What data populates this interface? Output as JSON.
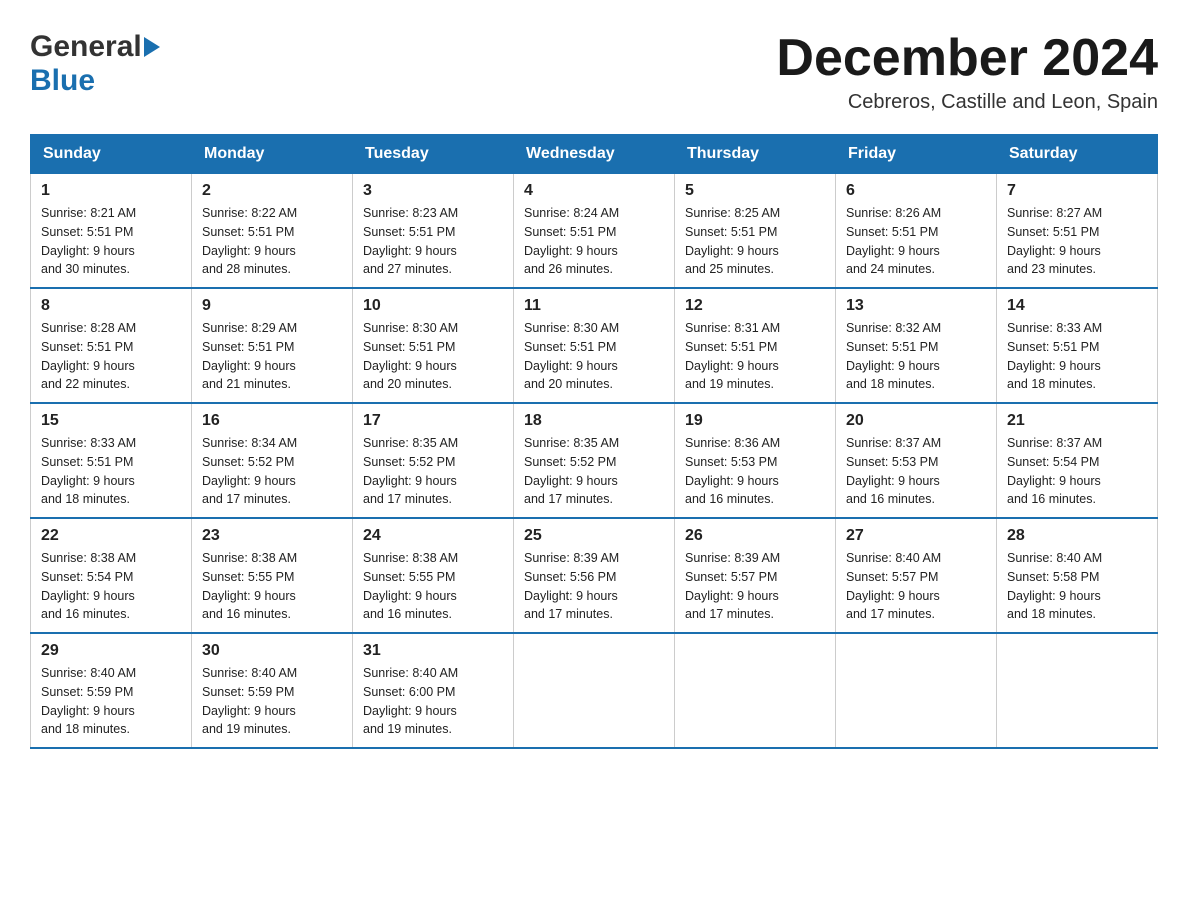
{
  "header": {
    "logo_general": "General",
    "logo_blue": "Blue",
    "month_title": "December 2024",
    "subtitle": "Cebreros, Castille and Leon, Spain"
  },
  "days_of_week": [
    "Sunday",
    "Monday",
    "Tuesday",
    "Wednesday",
    "Thursday",
    "Friday",
    "Saturday"
  ],
  "weeks": [
    [
      {
        "day": "1",
        "sunrise": "Sunrise: 8:21 AM",
        "sunset": "Sunset: 5:51 PM",
        "daylight": "Daylight: 9 hours",
        "daylight2": "and 30 minutes."
      },
      {
        "day": "2",
        "sunrise": "Sunrise: 8:22 AM",
        "sunset": "Sunset: 5:51 PM",
        "daylight": "Daylight: 9 hours",
        "daylight2": "and 28 minutes."
      },
      {
        "day": "3",
        "sunrise": "Sunrise: 8:23 AM",
        "sunset": "Sunset: 5:51 PM",
        "daylight": "Daylight: 9 hours",
        "daylight2": "and 27 minutes."
      },
      {
        "day": "4",
        "sunrise": "Sunrise: 8:24 AM",
        "sunset": "Sunset: 5:51 PM",
        "daylight": "Daylight: 9 hours",
        "daylight2": "and 26 minutes."
      },
      {
        "day": "5",
        "sunrise": "Sunrise: 8:25 AM",
        "sunset": "Sunset: 5:51 PM",
        "daylight": "Daylight: 9 hours",
        "daylight2": "and 25 minutes."
      },
      {
        "day": "6",
        "sunrise": "Sunrise: 8:26 AM",
        "sunset": "Sunset: 5:51 PM",
        "daylight": "Daylight: 9 hours",
        "daylight2": "and 24 minutes."
      },
      {
        "day": "7",
        "sunrise": "Sunrise: 8:27 AM",
        "sunset": "Sunset: 5:51 PM",
        "daylight": "Daylight: 9 hours",
        "daylight2": "and 23 minutes."
      }
    ],
    [
      {
        "day": "8",
        "sunrise": "Sunrise: 8:28 AM",
        "sunset": "Sunset: 5:51 PM",
        "daylight": "Daylight: 9 hours",
        "daylight2": "and 22 minutes."
      },
      {
        "day": "9",
        "sunrise": "Sunrise: 8:29 AM",
        "sunset": "Sunset: 5:51 PM",
        "daylight": "Daylight: 9 hours",
        "daylight2": "and 21 minutes."
      },
      {
        "day": "10",
        "sunrise": "Sunrise: 8:30 AM",
        "sunset": "Sunset: 5:51 PM",
        "daylight": "Daylight: 9 hours",
        "daylight2": "and 20 minutes."
      },
      {
        "day": "11",
        "sunrise": "Sunrise: 8:30 AM",
        "sunset": "Sunset: 5:51 PM",
        "daylight": "Daylight: 9 hours",
        "daylight2": "and 20 minutes."
      },
      {
        "day": "12",
        "sunrise": "Sunrise: 8:31 AM",
        "sunset": "Sunset: 5:51 PM",
        "daylight": "Daylight: 9 hours",
        "daylight2": "and 19 minutes."
      },
      {
        "day": "13",
        "sunrise": "Sunrise: 8:32 AM",
        "sunset": "Sunset: 5:51 PM",
        "daylight": "Daylight: 9 hours",
        "daylight2": "and 18 minutes."
      },
      {
        "day": "14",
        "sunrise": "Sunrise: 8:33 AM",
        "sunset": "Sunset: 5:51 PM",
        "daylight": "Daylight: 9 hours",
        "daylight2": "and 18 minutes."
      }
    ],
    [
      {
        "day": "15",
        "sunrise": "Sunrise: 8:33 AM",
        "sunset": "Sunset: 5:51 PM",
        "daylight": "Daylight: 9 hours",
        "daylight2": "and 18 minutes."
      },
      {
        "day": "16",
        "sunrise": "Sunrise: 8:34 AM",
        "sunset": "Sunset: 5:52 PM",
        "daylight": "Daylight: 9 hours",
        "daylight2": "and 17 minutes."
      },
      {
        "day": "17",
        "sunrise": "Sunrise: 8:35 AM",
        "sunset": "Sunset: 5:52 PM",
        "daylight": "Daylight: 9 hours",
        "daylight2": "and 17 minutes."
      },
      {
        "day": "18",
        "sunrise": "Sunrise: 8:35 AM",
        "sunset": "Sunset: 5:52 PM",
        "daylight": "Daylight: 9 hours",
        "daylight2": "and 17 minutes."
      },
      {
        "day": "19",
        "sunrise": "Sunrise: 8:36 AM",
        "sunset": "Sunset: 5:53 PM",
        "daylight": "Daylight: 9 hours",
        "daylight2": "and 16 minutes."
      },
      {
        "day": "20",
        "sunrise": "Sunrise: 8:37 AM",
        "sunset": "Sunset: 5:53 PM",
        "daylight": "Daylight: 9 hours",
        "daylight2": "and 16 minutes."
      },
      {
        "day": "21",
        "sunrise": "Sunrise: 8:37 AM",
        "sunset": "Sunset: 5:54 PM",
        "daylight": "Daylight: 9 hours",
        "daylight2": "and 16 minutes."
      }
    ],
    [
      {
        "day": "22",
        "sunrise": "Sunrise: 8:38 AM",
        "sunset": "Sunset: 5:54 PM",
        "daylight": "Daylight: 9 hours",
        "daylight2": "and 16 minutes."
      },
      {
        "day": "23",
        "sunrise": "Sunrise: 8:38 AM",
        "sunset": "Sunset: 5:55 PM",
        "daylight": "Daylight: 9 hours",
        "daylight2": "and 16 minutes."
      },
      {
        "day": "24",
        "sunrise": "Sunrise: 8:38 AM",
        "sunset": "Sunset: 5:55 PM",
        "daylight": "Daylight: 9 hours",
        "daylight2": "and 16 minutes."
      },
      {
        "day": "25",
        "sunrise": "Sunrise: 8:39 AM",
        "sunset": "Sunset: 5:56 PM",
        "daylight": "Daylight: 9 hours",
        "daylight2": "and 17 minutes."
      },
      {
        "day": "26",
        "sunrise": "Sunrise: 8:39 AM",
        "sunset": "Sunset: 5:57 PM",
        "daylight": "Daylight: 9 hours",
        "daylight2": "and 17 minutes."
      },
      {
        "day": "27",
        "sunrise": "Sunrise: 8:40 AM",
        "sunset": "Sunset: 5:57 PM",
        "daylight": "Daylight: 9 hours",
        "daylight2": "and 17 minutes."
      },
      {
        "day": "28",
        "sunrise": "Sunrise: 8:40 AM",
        "sunset": "Sunset: 5:58 PM",
        "daylight": "Daylight: 9 hours",
        "daylight2": "and 18 minutes."
      }
    ],
    [
      {
        "day": "29",
        "sunrise": "Sunrise: 8:40 AM",
        "sunset": "Sunset: 5:59 PM",
        "daylight": "Daylight: 9 hours",
        "daylight2": "and 18 minutes."
      },
      {
        "day": "30",
        "sunrise": "Sunrise: 8:40 AM",
        "sunset": "Sunset: 5:59 PM",
        "daylight": "Daylight: 9 hours",
        "daylight2": "and 19 minutes."
      },
      {
        "day": "31",
        "sunrise": "Sunrise: 8:40 AM",
        "sunset": "Sunset: 6:00 PM",
        "daylight": "Daylight: 9 hours",
        "daylight2": "and 19 minutes."
      },
      null,
      null,
      null,
      null
    ]
  ]
}
